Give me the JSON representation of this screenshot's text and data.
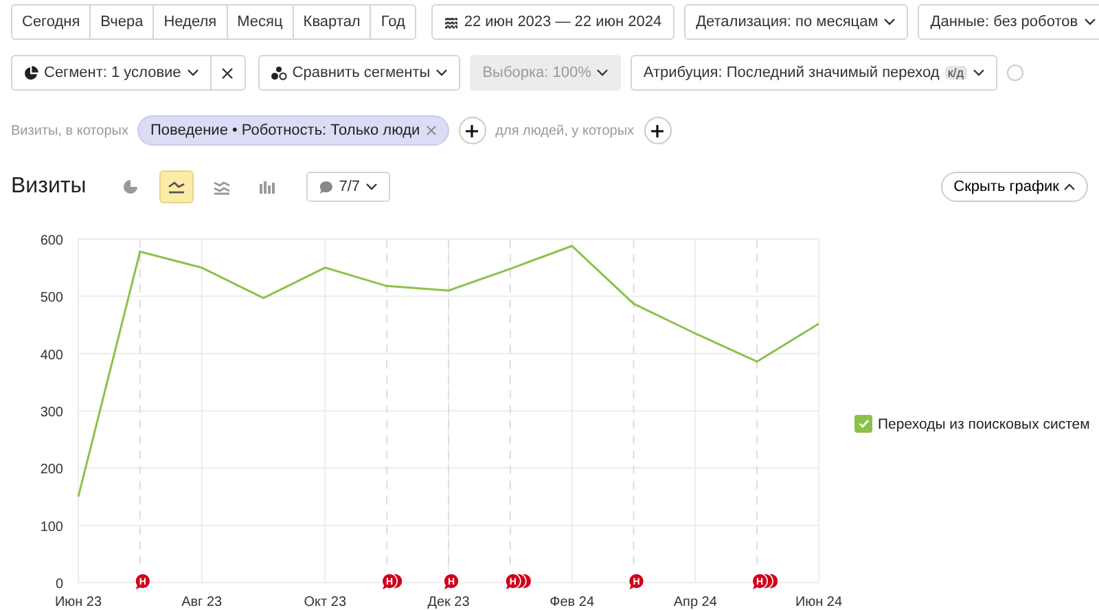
{
  "periods": [
    {
      "label": "Сегодня",
      "selected": false
    },
    {
      "label": "Вчера",
      "selected": false
    },
    {
      "label": "Неделя",
      "selected": false
    },
    {
      "label": "Месяц",
      "selected": false
    },
    {
      "label": "Квартал",
      "selected": false
    },
    {
      "label": "Год",
      "selected": false
    }
  ],
  "date_range": "22 июн 2023 — 22 июн 2024",
  "detail_dropdown": "Детализация: по месяцам",
  "data_dropdown": "Данные: без роботов",
  "segment_dropdown": "Сегмент: 1 условие",
  "compare_dropdown": "Сравнить сегменты",
  "sample_dropdown": {
    "label": "Выборка: 100%",
    "disabled": true
  },
  "attribution_dropdown": {
    "label": "Атрибуция: Последний значимый переход",
    "badge": "к/д"
  },
  "filter": {
    "prefix": "Визиты, в которых",
    "chip": "Поведение • Роботность: Только люди",
    "people_label": "для людей, у которых"
  },
  "report": {
    "title": "Визиты",
    "chart_types": [
      {
        "kind": "pie",
        "selected": false
      },
      {
        "kind": "line",
        "selected": true
      },
      {
        "kind": "area",
        "selected": false
      },
      {
        "kind": "bars",
        "selected": false
      }
    ],
    "notes_filter": "7/7",
    "hide_chart": "Скрыть график"
  },
  "chart_data": {
    "type": "line",
    "categories": [
      "Июн 23",
      null,
      "Авг 23",
      null,
      "Окт 23",
      null,
      "Дек 23",
      null,
      "Фев 24",
      null,
      "Апр 24",
      null,
      "Июн 24"
    ],
    "grid": true,
    "ylim": [
      0,
      600
    ],
    "yticks": [
      0,
      100,
      200,
      300,
      400,
      500,
      600
    ],
    "series": [
      {
        "name": "Переходы из поисковых систем",
        "color": "#8ac248",
        "values": [
          150,
          578,
          550,
          497,
          550,
          518,
          510,
          548,
          588,
          487,
          435,
          386,
          452
        ]
      }
    ]
  },
  "note_markers": [
    {
      "kind": "none"
    },
    {
      "label": "Н",
      "kind": "single"
    },
    {
      "kind": "none"
    },
    {
      "kind": "none"
    },
    {
      "kind": "none"
    },
    {
      "label": "Н",
      "kind": "double"
    },
    {
      "label": "Н",
      "kind": "single"
    },
    {
      "label": "Н",
      "kind": "triple"
    },
    {
      "kind": "none"
    },
    {
      "label": "Н",
      "kind": "single"
    },
    {
      "kind": "none"
    },
    {
      "label": "Н",
      "kind": "triple"
    },
    {
      "kind": "none"
    }
  ],
  "legend": [
    {
      "checked": true
    }
  ]
}
